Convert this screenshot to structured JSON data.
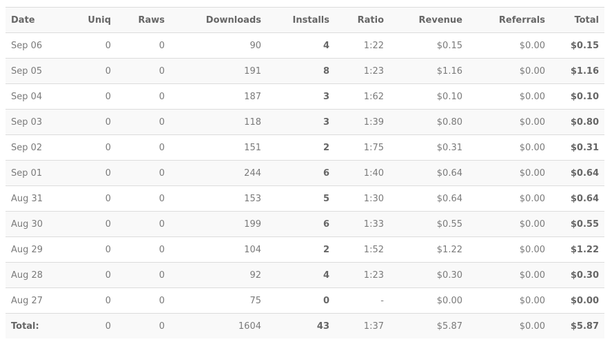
{
  "headers": [
    "Date",
    "Uniq",
    "Raws",
    "Downloads",
    "Installs",
    "Ratio",
    "Revenue",
    "Referrals",
    "Total"
  ],
  "rows": [
    [
      "Sep 06",
      "0",
      "0",
      "90",
      "4",
      "1:22",
      "$0.15",
      "$0.00",
      "$0.15"
    ],
    [
      "Sep 05",
      "0",
      "0",
      "191",
      "8",
      "1:23",
      "$1.16",
      "$0.00",
      "$1.16"
    ],
    [
      "Sep 04",
      "0",
      "0",
      "187",
      "3",
      "1:62",
      "$0.10",
      "$0.00",
      "$0.10"
    ],
    [
      "Sep 03",
      "0",
      "0",
      "118",
      "3",
      "1:39",
      "$0.80",
      "$0.00",
      "$0.80"
    ],
    [
      "Sep 02",
      "0",
      "0",
      "151",
      "2",
      "1:75",
      "$0.31",
      "$0.00",
      "$0.31"
    ],
    [
      "Sep 01",
      "0",
      "0",
      "244",
      "6",
      "1:40",
      "$0.64",
      "$0.00",
      "$0.64"
    ],
    [
      "Aug 31",
      "0",
      "0",
      "153",
      "5",
      "1:30",
      "$0.64",
      "$0.00",
      "$0.64"
    ],
    [
      "Aug 30",
      "0",
      "0",
      "199",
      "6",
      "1:33",
      "$0.55",
      "$0.00",
      "$0.55"
    ],
    [
      "Aug 29",
      "0",
      "0",
      "104",
      "2",
      "1:52",
      "$1.22",
      "$0.00",
      "$1.22"
    ],
    [
      "Aug 28",
      "0",
      "0",
      "92",
      "4",
      "1:23",
      "$0.30",
      "$0.00",
      "$0.30"
    ],
    [
      "Aug 27",
      "0",
      "0",
      "75",
      "0",
      "-",
      "$0.00",
      "$0.00",
      "$0.00"
    ]
  ],
  "total": [
    "Total:",
    "0",
    "0",
    "1604",
    "43",
    "1:37",
    "$5.87",
    "$0.00",
    "$5.87"
  ]
}
